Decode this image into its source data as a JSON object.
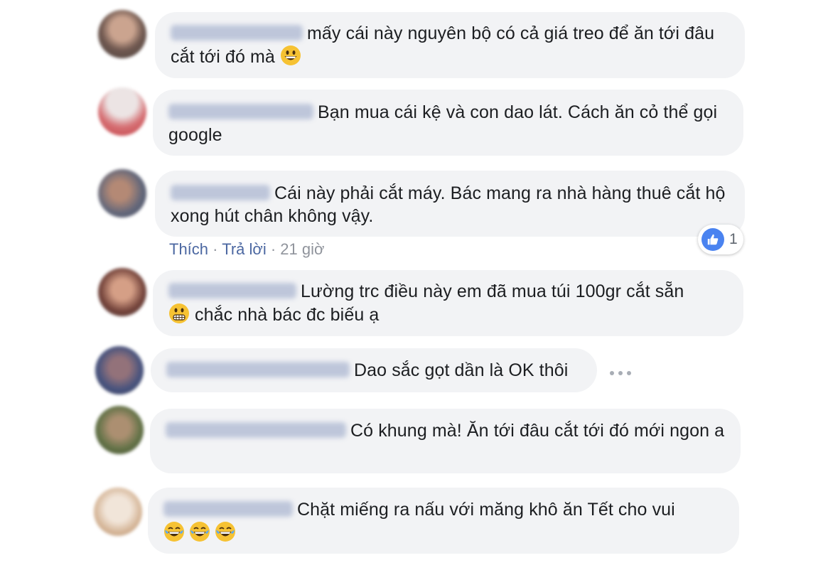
{
  "comments": [
    {
      "text": "mấy cái này nguyên bộ có cả giá treo để ăn tới đâu cắt tới đó mà",
      "emojis": [
        "grinning"
      ]
    },
    {
      "text": "Bạn mua cái kệ và con dao lát. Cách ăn cỏ thể gọi google",
      "emojis": []
    },
    {
      "text": "Cái này phải cắt máy. Bác mang ra nhà hàng thuê cắt hộ xong hút chân không vậy.",
      "emojis": []
    },
    {
      "text": "Lường trc điều này em đã mua túi 100gr cắt sẵn",
      "text2": "chắc nhà bác đc biếu ạ",
      "emojis": [
        "grimacing"
      ]
    },
    {
      "text": "Dao sắc gọt dần là OK thôi",
      "emojis": []
    },
    {
      "text": "Có khung mà! Ăn tới đâu cắt tới đó mới ngon a",
      "emojis": []
    },
    {
      "text": "Chặt miếng ra nấu với măng khô ăn Tết cho vui",
      "emojis": [
        "joy",
        "joy",
        "joy"
      ]
    }
  ],
  "actions": {
    "like": "Thích",
    "sep1": "·",
    "reply": "Trả lời",
    "sep2": "·",
    "time": "21 giờ"
  },
  "reaction": {
    "icon": "like-icon",
    "count": "1"
  },
  "colors": {
    "bubble": "#f2f3f5",
    "link": "#4b67a1",
    "muted": "#90949c",
    "like": "#4a83f0"
  }
}
